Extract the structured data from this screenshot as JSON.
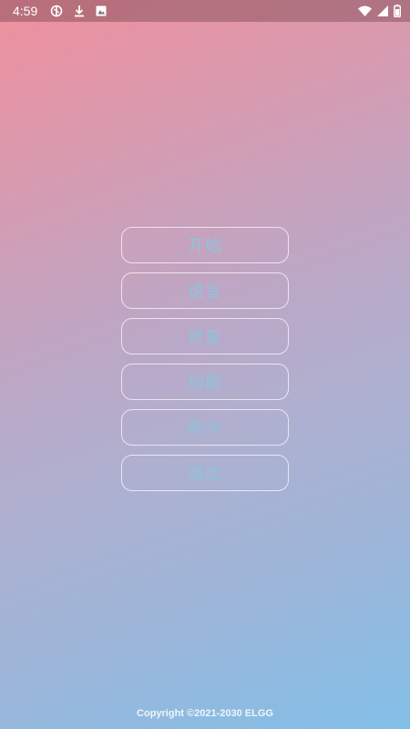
{
  "status_bar": {
    "time": "4:59",
    "left_icons": [
      "settings-shield-icon",
      "download-icon",
      "image-icon"
    ],
    "right_icons": [
      "wifi-icon",
      "signal-icon",
      "battery-icon"
    ]
  },
  "menu": {
    "items": [
      {
        "label": "开始"
      },
      {
        "label": "语言"
      },
      {
        "label": "修复"
      },
      {
        "label": "加群"
      },
      {
        "label": "购卡"
      },
      {
        "label": "退出"
      }
    ]
  },
  "footer": {
    "copyright": "Copyright ©2021-2030 ELGG"
  },
  "colors": {
    "gradient_top": "#f0909e",
    "gradient_bottom": "#82bfe8",
    "button_text": "#8ec3dc",
    "button_border": "#ffffff"
  }
}
